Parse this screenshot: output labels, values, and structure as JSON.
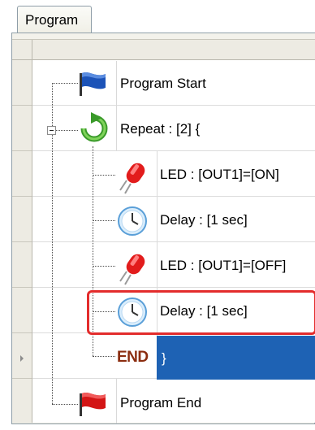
{
  "tab": {
    "label": "Program"
  },
  "rows": [
    {
      "label": "Program Start",
      "icon": "blue-flag-icon"
    },
    {
      "label": "Repeat : [2] {",
      "icon": "loop-arrow-icon"
    },
    {
      "label": "LED : [OUT1]=[ON]",
      "icon": "red-led-icon"
    },
    {
      "label": "Delay : [1 sec]",
      "icon": "clock-icon"
    },
    {
      "label": "LED : [OUT1]=[OFF]",
      "icon": "red-led-icon"
    },
    {
      "label": "Delay : [1 sec]",
      "icon": "clock-icon",
      "highlighted": true
    },
    {
      "label": "}",
      "icon": "end-label",
      "end_text": "END",
      "selected": true
    },
    {
      "label": "Program End",
      "icon": "red-flag-icon"
    }
  ],
  "colors": {
    "selection": "#1e62b4",
    "highlight_border": "#e32c2c",
    "end_text": "#8b2d10"
  }
}
